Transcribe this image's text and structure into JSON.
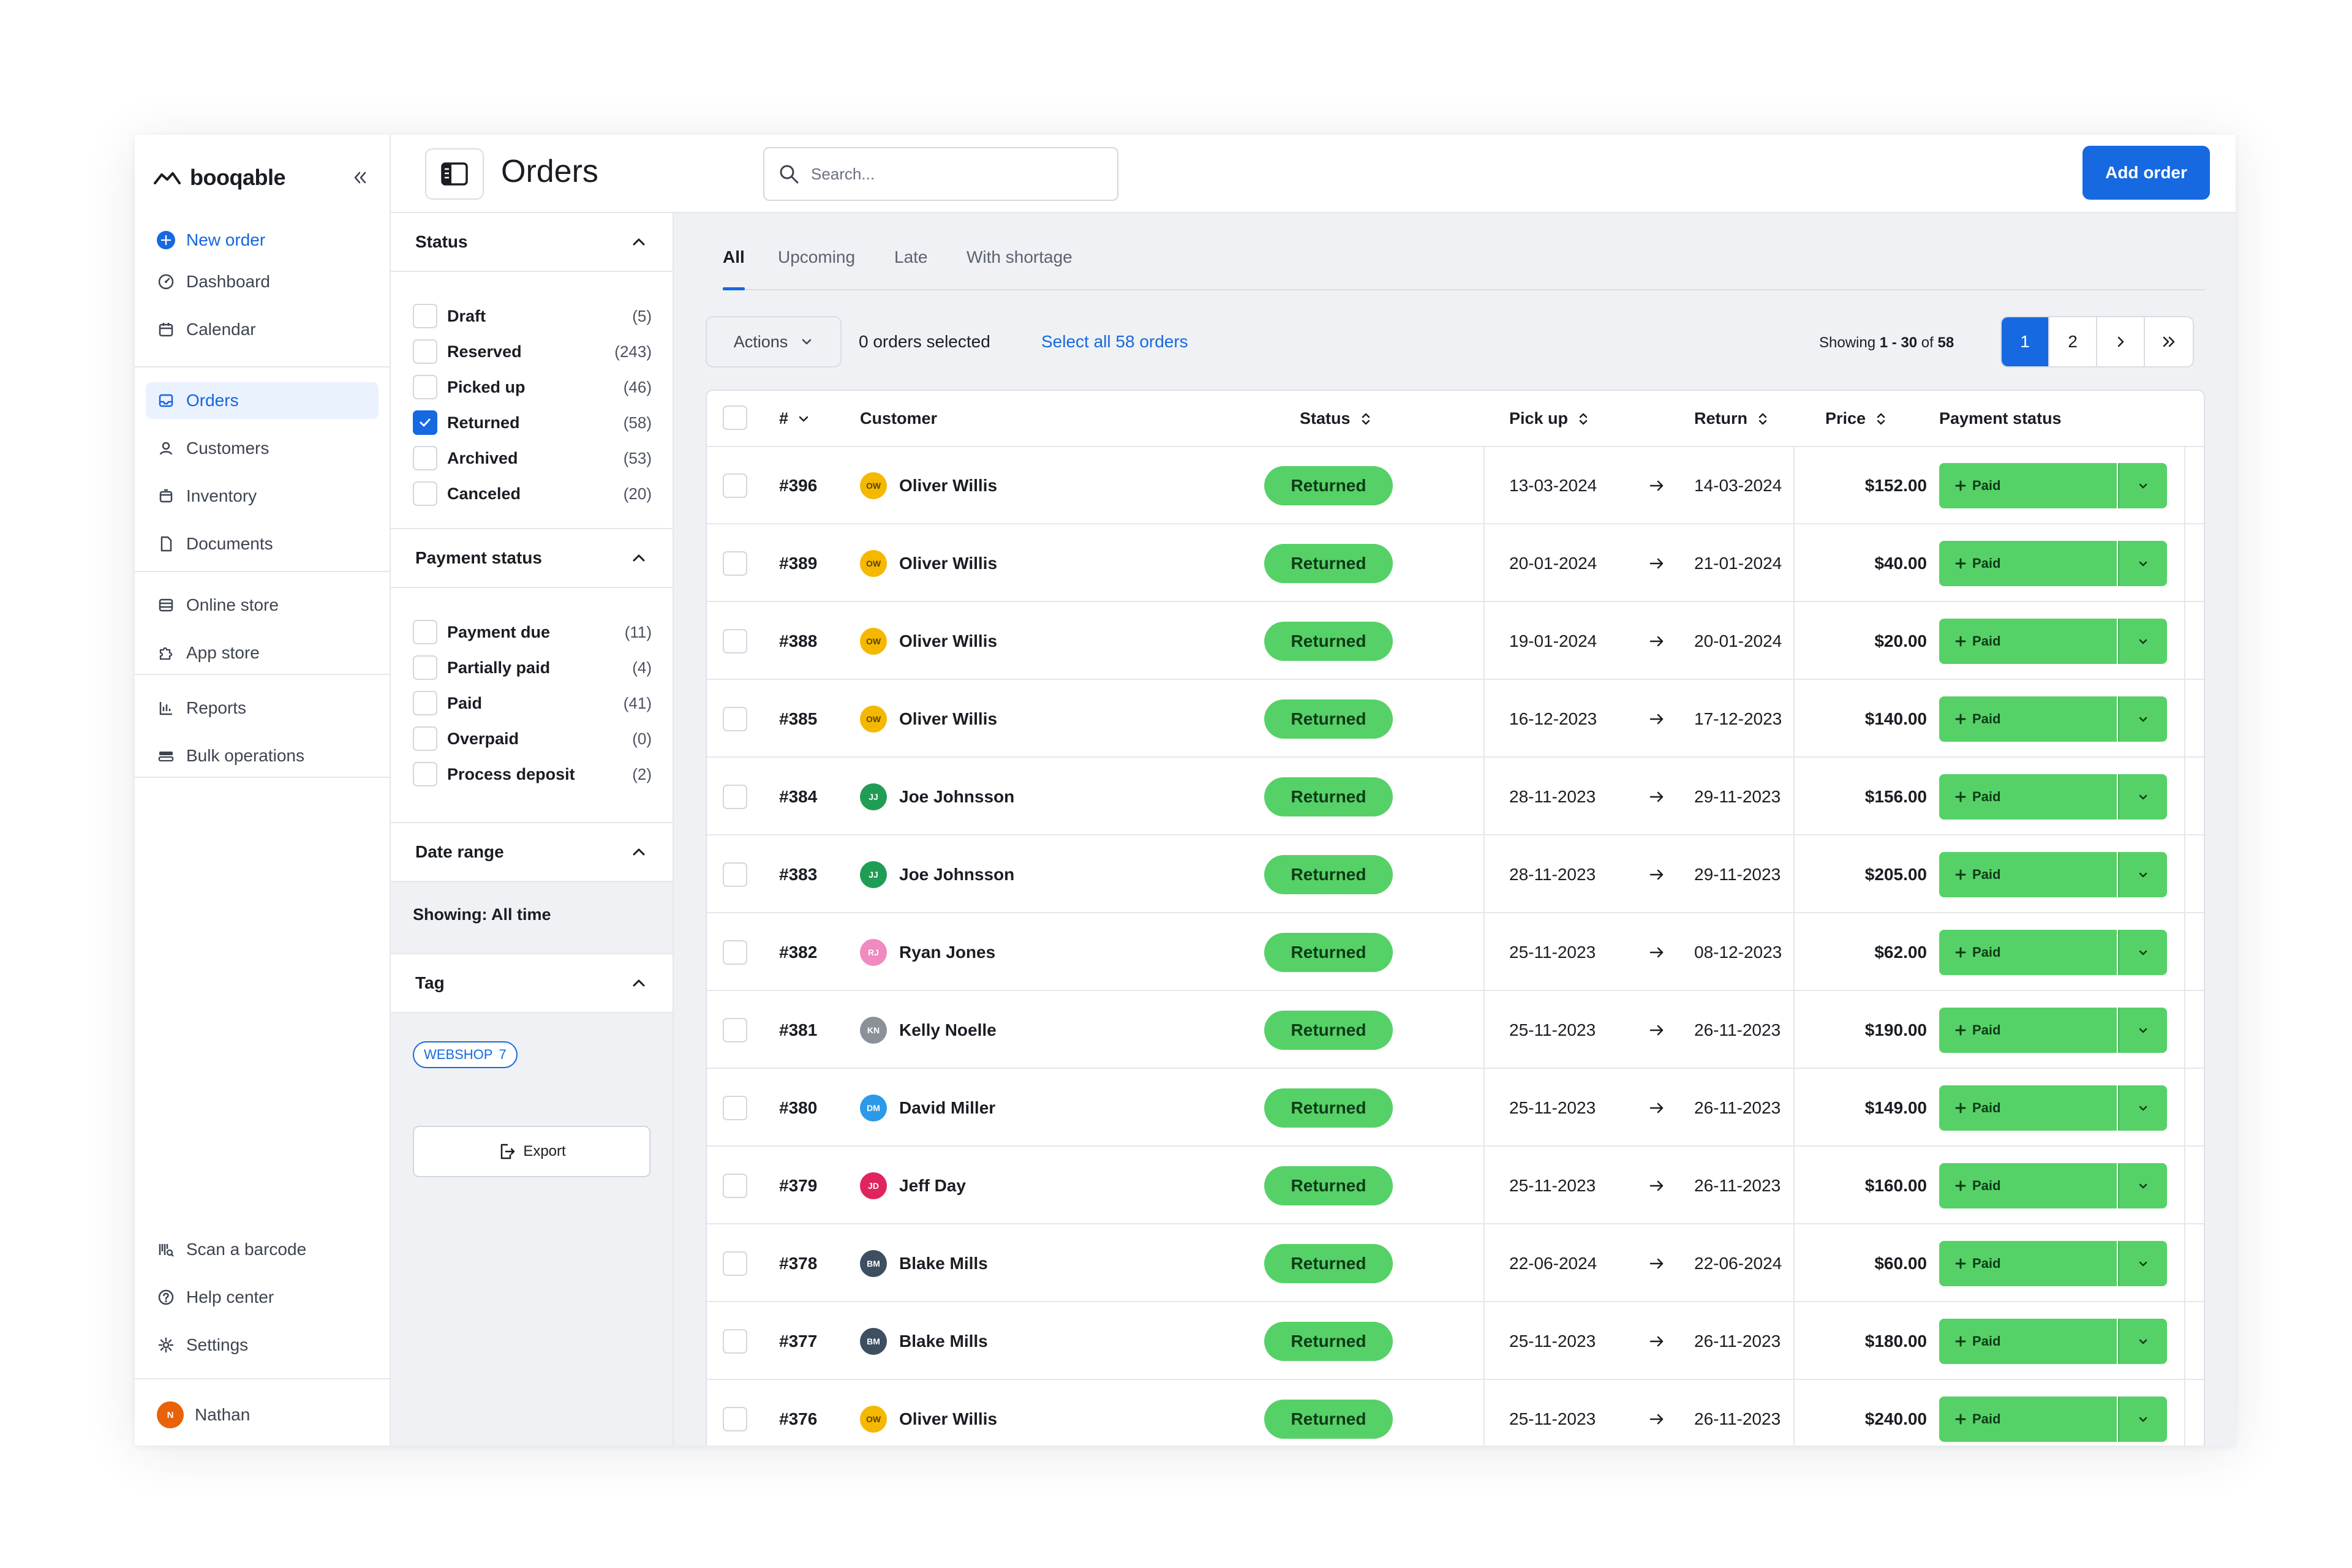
{
  "app": {
    "brand": "booqable"
  },
  "nav": {
    "new_order": "New order",
    "group1": [
      {
        "label": "Dashboard",
        "icon": "dashboard-icon"
      },
      {
        "label": "Calendar",
        "icon": "calendar-icon"
      }
    ],
    "group2": [
      {
        "label": "Orders",
        "icon": "inbox-icon",
        "active": true
      },
      {
        "label": "Customers",
        "icon": "user-icon"
      },
      {
        "label": "Inventory",
        "icon": "box-icon"
      },
      {
        "label": "Documents",
        "icon": "document-icon"
      }
    ],
    "group3": [
      {
        "label": "Online store",
        "icon": "store-icon"
      },
      {
        "label": "App store",
        "icon": "puzzle-icon"
      }
    ],
    "group4": [
      {
        "label": "Reports",
        "icon": "chart-icon"
      },
      {
        "label": "Bulk operations",
        "icon": "bulk-icon"
      }
    ],
    "bottom": [
      {
        "label": "Scan a barcode",
        "icon": "barcode-icon"
      },
      {
        "label": "Help center",
        "icon": "help-icon"
      },
      {
        "label": "Settings",
        "icon": "gear-icon"
      }
    ],
    "user": {
      "name": "Nathan",
      "initials": "N"
    }
  },
  "header": {
    "title": "Orders",
    "search_placeholder": "Search...",
    "add_order": "Add order"
  },
  "filters": {
    "status": {
      "title": "Status",
      "items": [
        {
          "label": "Draft",
          "count": "(5)",
          "checked": false
        },
        {
          "label": "Reserved",
          "count": "(243)",
          "checked": false
        },
        {
          "label": "Picked up",
          "count": "(46)",
          "checked": false
        },
        {
          "label": "Returned",
          "count": "(58)",
          "checked": true
        },
        {
          "label": "Archived",
          "count": "(53)",
          "checked": false
        },
        {
          "label": "Canceled",
          "count": "(20)",
          "checked": false
        }
      ]
    },
    "payment": {
      "title": "Payment status",
      "items": [
        {
          "label": "Payment due",
          "count": "(11)",
          "checked": false
        },
        {
          "label": "Partially paid",
          "count": "(4)",
          "checked": false
        },
        {
          "label": "Paid",
          "count": "(41)",
          "checked": false
        },
        {
          "label": "Overpaid",
          "count": "(0)",
          "checked": false
        },
        {
          "label": "Process deposit",
          "count": "(2)",
          "checked": false
        }
      ]
    },
    "date_range": {
      "title": "Date range",
      "showing": "Showing: All time"
    },
    "tag": {
      "title": "Tag",
      "chip_label": "WEBSHOP",
      "chip_count": "7"
    },
    "export": "Export"
  },
  "tabs": [
    "All",
    "Upcoming",
    "Late",
    "With shortage"
  ],
  "toolbar": {
    "actions": "Actions",
    "selected": "0 orders selected",
    "select_all": "Select all 58 orders",
    "showing_prefix": "Showing ",
    "showing_range": "1 - 30",
    "showing_of": " of ",
    "showing_total": "58",
    "pages": [
      "1",
      "2"
    ]
  },
  "table": {
    "columns": {
      "num": "#",
      "customer": "Customer",
      "status": "Status",
      "pickup": "Pick up",
      "return": "Return",
      "price": "Price",
      "payment": "Payment status"
    },
    "rows": [
      {
        "num": "#396",
        "initials": "OW",
        "customer": "Oliver Willis",
        "status": "Returned",
        "pickup": "13-03-2024",
        "return": "14-03-2024",
        "price": "$152.00",
        "payment": "Paid",
        "avatar_color": "#f5b800"
      },
      {
        "num": "#389",
        "initials": "OW",
        "customer": "Oliver Willis",
        "status": "Returned",
        "pickup": "20-01-2024",
        "return": "21-01-2024",
        "price": "$40.00",
        "payment": "Paid",
        "avatar_color": "#f5b800"
      },
      {
        "num": "#388",
        "initials": "OW",
        "customer": "Oliver Willis",
        "status": "Returned",
        "pickup": "19-01-2024",
        "return": "20-01-2024",
        "price": "$20.00",
        "payment": "Paid",
        "avatar_color": "#f5b800"
      },
      {
        "num": "#385",
        "initials": "OW",
        "customer": "Oliver Willis",
        "status": "Returned",
        "pickup": "16-12-2023",
        "return": "17-12-2023",
        "price": "$140.00",
        "payment": "Paid",
        "avatar_color": "#f5b800"
      },
      {
        "num": "#384",
        "initials": "JJ",
        "customer": "Joe Johnsson",
        "status": "Returned",
        "pickup": "28-11-2023",
        "return": "29-11-2023",
        "price": "$156.00",
        "payment": "Paid",
        "avatar_color": "#1f9d55"
      },
      {
        "num": "#383",
        "initials": "JJ",
        "customer": "Joe Johnsson",
        "status": "Returned",
        "pickup": "28-11-2023",
        "return": "29-11-2023",
        "price": "$205.00",
        "payment": "Paid",
        "avatar_color": "#1f9d55"
      },
      {
        "num": "#382",
        "initials": "RJ",
        "customer": "Ryan Jones",
        "status": "Returned",
        "pickup": "25-11-2023",
        "return": "08-12-2023",
        "price": "$62.00",
        "payment": "Paid",
        "avatar_color": "#f08ac0"
      },
      {
        "num": "#381",
        "initials": "KN",
        "customer": "Kelly Noelle",
        "status": "Returned",
        "pickup": "25-11-2023",
        "return": "26-11-2023",
        "price": "$190.00",
        "payment": "Paid",
        "avatar_color": "#8a9199"
      },
      {
        "num": "#380",
        "initials": "DM",
        "customer": "David Miller",
        "status": "Returned",
        "pickup": "25-11-2023",
        "return": "26-11-2023",
        "price": "$149.00",
        "payment": "Paid",
        "avatar_color": "#2b9ae8"
      },
      {
        "num": "#379",
        "initials": "JD",
        "customer": "Jeff Day",
        "status": "Returned",
        "pickup": "25-11-2023",
        "return": "26-11-2023",
        "price": "$160.00",
        "payment": "Paid",
        "avatar_color": "#e0245e"
      },
      {
        "num": "#378",
        "initials": "BM",
        "customer": "Blake Mills",
        "status": "Returned",
        "pickup": "22-06-2024",
        "return": "22-06-2024",
        "price": "$60.00",
        "payment": "Paid",
        "avatar_color": "#3d4f60"
      },
      {
        "num": "#377",
        "initials": "BM",
        "customer": "Blake Mills",
        "status": "Returned",
        "pickup": "25-11-2023",
        "return": "26-11-2023",
        "price": "$180.00",
        "payment": "Paid",
        "avatar_color": "#3d4f60"
      },
      {
        "num": "#376",
        "initials": "OW",
        "customer": "Oliver Willis",
        "status": "Returned",
        "pickup": "25-11-2023",
        "return": "26-11-2023",
        "price": "$240.00",
        "payment": "Paid",
        "avatar_color": "#f5b800"
      }
    ]
  },
  "colors": {
    "accent": "#1669e0",
    "status_green": "#56d167",
    "background": "#eff1f4"
  }
}
